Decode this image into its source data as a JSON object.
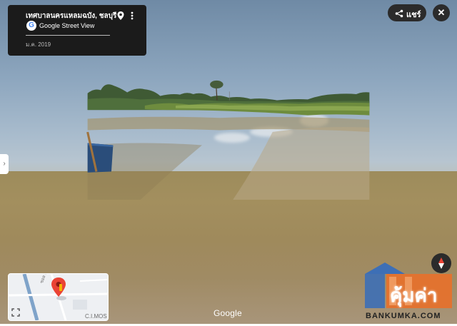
{
  "info_card": {
    "place_title": "เทศบาลนครแหลมฉบัง, ชลบุรี",
    "service_label": "Google Street View",
    "capture_date": "ม.ค. 2019",
    "icons": [
      "map-pin-icon",
      "more-vert-icon",
      "google-g-icon"
    ]
  },
  "toolbar": {
    "share_label": "แชร์",
    "close_symbol": "✕",
    "icons": [
      "share-icon",
      "close-icon"
    ]
  },
  "side_tab": {
    "symbol": "›"
  },
  "minimap": {
    "street_label": "ซอย บ้าง",
    "poi_label": "C.I.MOS",
    "icons": [
      "location-marker-icon",
      "expand-icon"
    ]
  },
  "watermark": {
    "text": "Google"
  },
  "brand": {
    "logo_word": "คุ้มค่า",
    "site_name": "BANKUMKA.COM"
  },
  "colors": {
    "card_bg": "#1b1b1b",
    "button_bg": "#2b2b2b",
    "brand_blue": "#3d6fb6",
    "brand_orange": "#e8702a",
    "marker_red": "#ea4335"
  }
}
